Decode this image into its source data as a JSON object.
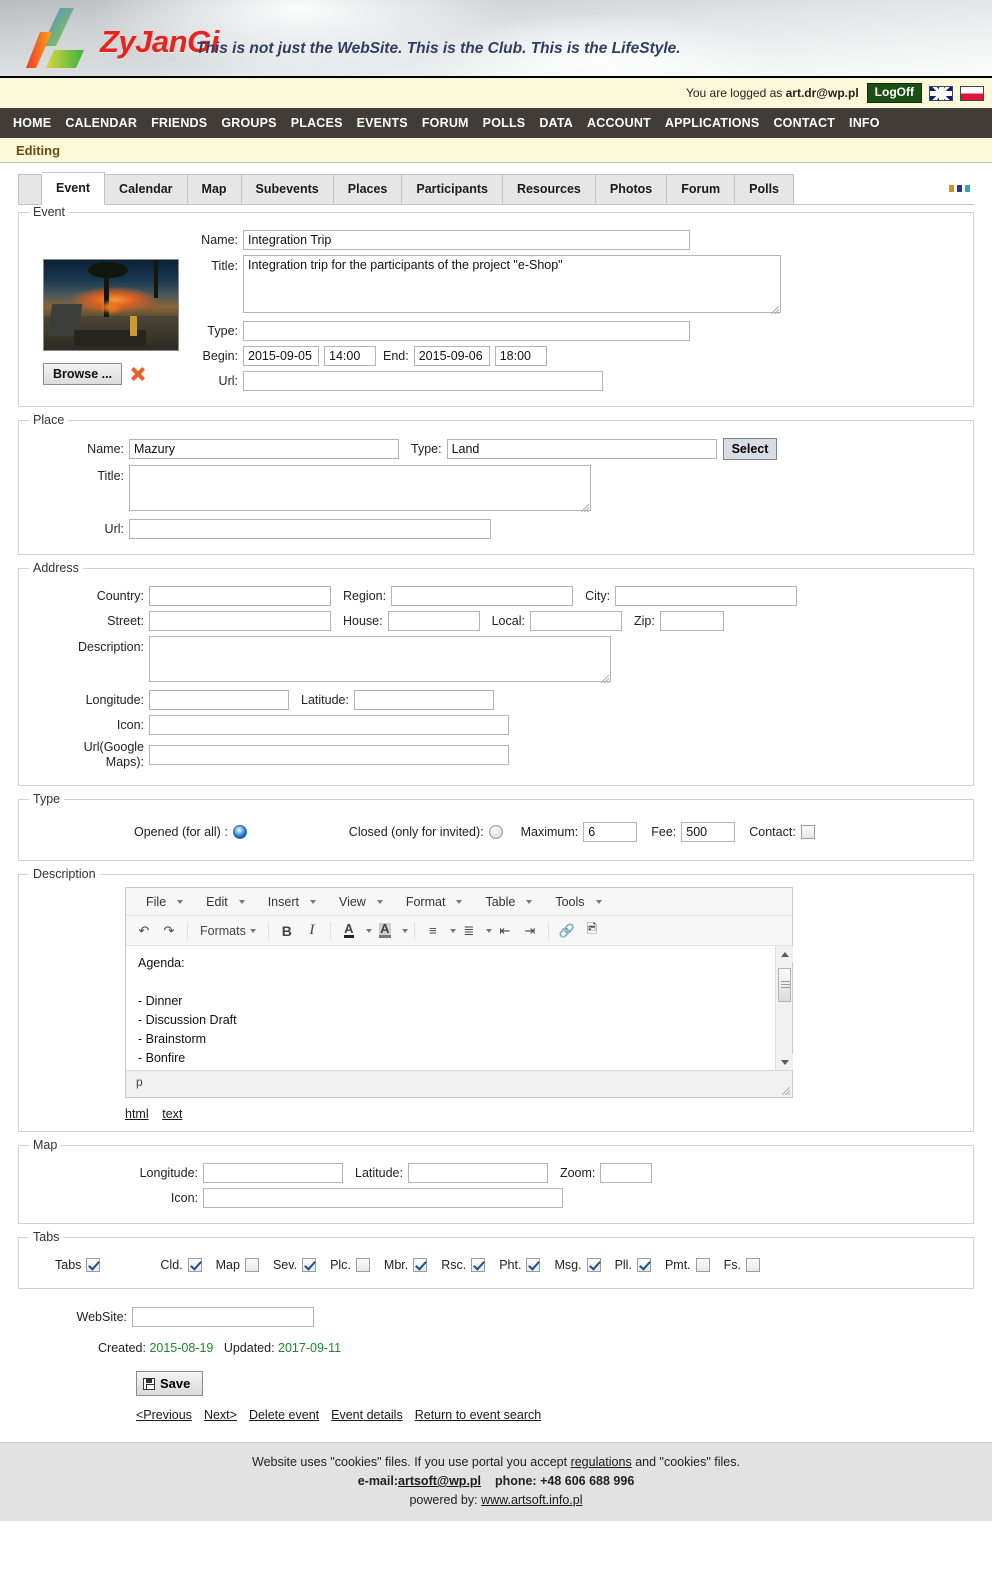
{
  "header": {
    "brand": "ZyJanGi",
    "tagline": "This is not just the WebSite. This is the Club. This is the LifeStyle.",
    "brand_color": "#e8221c",
    "tagline_color": "#2c3e63"
  },
  "loginbar": {
    "logged_text": "You are logged as",
    "user": "art.dr@wp.pl",
    "logoff_label": "LogOff",
    "logoff_color": "#1d4f15",
    "flags": [
      "uk-flag-icon",
      "poland-flag-icon"
    ]
  },
  "nav": {
    "items": [
      "HOME",
      "CALENDAR",
      "FRIENDS",
      "GROUPS",
      "PLACES",
      "EVENTS",
      "FORUM",
      "POLLS",
      "DATA",
      "ACCOUNT",
      "APPLICATIONS",
      "CONTACT",
      "INFO"
    ],
    "bar_color": "#413c38"
  },
  "breadcrumb": {
    "text": "Editing",
    "color": "#6b4a12"
  },
  "tabs": {
    "items": [
      "Event",
      "Calendar",
      "Map",
      "Subevents",
      "Places",
      "Participants",
      "Resources",
      "Photos",
      "Forum",
      "Polls"
    ],
    "active": "Event",
    "overflow": "..."
  },
  "event": {
    "legend": "Event",
    "name_label": "Name:",
    "name_value": "Integration Trip",
    "title_label": "Title:",
    "title_value": "Integration trip for the participants of the project \"e-Shop\"",
    "type_label": "Type:",
    "type_value": "",
    "begin_label": "Begin:",
    "begin_date": "2015-09-05",
    "begin_time": "14:00",
    "end_label": "End:",
    "end_date": "2015-09-06",
    "end_time": "18:00",
    "url_label": "Url:",
    "url_value": "",
    "browse_label": "Browse ...",
    "photo_alt": "campsite-sunset-photo"
  },
  "place": {
    "legend": "Place",
    "name_label": "Name:",
    "name_value": "Mazury",
    "type_label": "Type:",
    "type_value": "Land",
    "select_label": "Select",
    "title_label": "Title:",
    "title_value": "",
    "url_label": "Url:",
    "url_value": ""
  },
  "address": {
    "legend": "Address",
    "country_label": "Country:",
    "country_value": "",
    "region_label": "Region:",
    "region_value": "",
    "city_label": "City:",
    "city_value": "",
    "street_label": "Street:",
    "street_value": "",
    "house_label": "House:",
    "house_value": "",
    "local_label": "Local:",
    "local_value": "",
    "zip_label": "Zip:",
    "zip_value": "",
    "description_label": "Description:",
    "description_value": "",
    "longitude_label": "Longitude:",
    "longitude_value": "",
    "latitude_label": "Latitude:",
    "latitude_value": "",
    "icon_label": "Icon:",
    "icon_value": "",
    "gmaps_label": "Url(Google Maps):",
    "gmaps_value": ""
  },
  "type": {
    "legend": "Type",
    "opened_label": "Opened (for all) :",
    "opened_selected": true,
    "closed_label": "Closed (only for invited):",
    "closed_selected": false,
    "maximum_label": "Maximum:",
    "maximum_value": "6",
    "fee_label": "Fee:",
    "fee_value": "500",
    "contact_label": "Contact:",
    "contact_checked": false
  },
  "description": {
    "legend": "Description",
    "menubar": [
      "File",
      "Edit",
      "Insert",
      "View",
      "Format",
      "Table",
      "Tools"
    ],
    "toolbar": {
      "undo": "undo-icon",
      "redo": "redo-icon",
      "formats": "Formats",
      "bold": "B",
      "italic": "I",
      "forecolor": "A",
      "backcolor": "A",
      "bullist": "bullet-list-icon",
      "numlist": "numbered-list-icon",
      "outdent": "outdent-icon",
      "indent": "indent-icon",
      "link": "link-icon",
      "image": "image-icon"
    },
    "content_lines": [
      "Agenda:",
      "",
      "- Dinner",
      "- Discussion Draft",
      "- Brainstorm",
      "- Bonfire"
    ],
    "statusbar": "p",
    "links": [
      "html",
      "text"
    ]
  },
  "map": {
    "legend": "Map",
    "longitude_label": "Longitude:",
    "longitude_value": "",
    "latitude_label": "Latitude:",
    "latitude_value": "",
    "zoom_label": "Zoom:",
    "zoom_value": "",
    "icon_label": "Icon:",
    "icon_value": ""
  },
  "tabs_section": {
    "legend": "Tabs",
    "items": [
      {
        "label": "Tabs",
        "checked": true
      },
      {
        "label": "Cld.",
        "checked": true
      },
      {
        "label": "Map",
        "checked": false
      },
      {
        "label": "Sev.",
        "checked": true
      },
      {
        "label": "Plc.",
        "checked": false
      },
      {
        "label": "Mbr.",
        "checked": true
      },
      {
        "label": "Rsc.",
        "checked": true
      },
      {
        "label": "Pht.",
        "checked": true
      },
      {
        "label": "Msg.",
        "checked": true
      },
      {
        "label": "Pll.",
        "checked": true
      },
      {
        "label": "Pmt.",
        "checked": false
      },
      {
        "label": "Fs.",
        "checked": false
      }
    ]
  },
  "website": {
    "label": "WebSite:",
    "value": ""
  },
  "meta": {
    "created_label": "Created:",
    "created_date": "2015-08-19",
    "updated_label": "Updated:",
    "updated_date": "2017-09-11",
    "date_color": "#1a8a2a"
  },
  "actions": {
    "save_label": "Save",
    "links": [
      "<Previous",
      "Next>",
      "Delete event",
      "Event details",
      "Return to event search"
    ]
  },
  "footer": {
    "line1_a": "Website uses \"cookies\" files. If you use portal you accept ",
    "line1_link": "regulations",
    "line1_b": " and \"cookies\" files.",
    "email_label": "e-mail:",
    "email": "artsoft@wp.pl",
    "phone_label": "phone:",
    "phone": "+48 606 688 996",
    "powered_label": "powered by:",
    "powered_link": "www.artsoft.info.pl"
  }
}
